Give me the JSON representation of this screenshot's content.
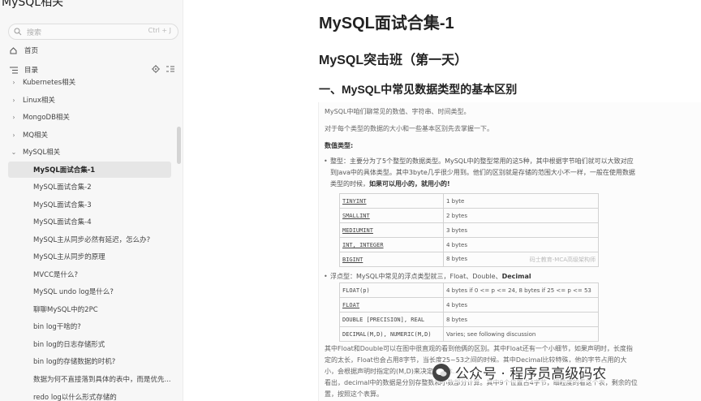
{
  "app": {
    "title": "MySQL相关"
  },
  "search": {
    "placeholder": "搜索",
    "shortcut": "Ctrl + J"
  },
  "nav": {
    "home": "首页",
    "toc": "目录"
  },
  "tree": [
    {
      "label": "Kubernetes相关",
      "expanded": false
    },
    {
      "label": "Linux相关",
      "expanded": false
    },
    {
      "label": "MongoDB相关",
      "expanded": false
    },
    {
      "label": "MQ相关",
      "expanded": false
    },
    {
      "label": "MySQL相关",
      "expanded": true
    }
  ],
  "children": [
    "MySQL面试合集-1",
    "MySQL面试合集-2",
    "MySQL面试合集-3",
    "MySQL面试合集-4",
    "MySQL主从同步必然有延迟，怎么办?",
    "MySQL主从同步的原理",
    "MVCC是什么?",
    "MySQL undo log是什么?",
    "聊聊MySQL中的2PC",
    "bin log干啥的?",
    "bin log的日志存储形式",
    "bin log的存储数据的时机?",
    "数据为何不直接落到具体的表中，而是优先...",
    "redo log以什么形式存储的"
  ],
  "article": {
    "title": "MySQL面试合集-1",
    "subtitle": "MySQL突击班（第一天）",
    "section": "一、MySQL中常见数据类型的基本区别",
    "intro1": "MySQL中咱们聊常见的数值、字符串、时间类型。",
    "intro2": "对于每个类型的数据的大小和一些基本区别先去掌握一下。",
    "numeric_heading": "数值类型:",
    "int_text_a": "整型：主要分为了5个整型的数据类型。MySQL中的整型常用的这5种，其中根据字节咱们就可以大致对应",
    "int_text_b": "到Java中的具体类型。其中3byte几乎很少用到。他们的区别就是存储的范围大小不一样，一般在使用数据",
    "int_text_c": "类型的时候，",
    "int_text_bold": "如果可以用小的，就用小的!",
    "int_table": [
      {
        "type": "TINYINT",
        "size": "1 byte"
      },
      {
        "type": "SMALLINT",
        "size": "2 bytes"
      },
      {
        "type": "MEDIUMINT",
        "size": "3 bytes"
      },
      {
        "type": "INT, INTEGER",
        "size": "4 bytes"
      },
      {
        "type": "BIGINT",
        "size": "8 bytes"
      }
    ],
    "float_text_a": "浮点型：MySQL中常见的浮点类型就三，Float、Double、",
    "float_text_bold": "Decimal",
    "float_table": [
      {
        "type": "FLOAT(p)",
        "size": "4 bytes if 0 <= p <= 24, 8 bytes if 25 <= p <= 53"
      },
      {
        "type": "FLOAT",
        "size": "4 bytes"
      },
      {
        "type": "DOUBLE [PRECISION], REAL",
        "size": "8 bytes"
      },
      {
        "type": "DECIMAL(M,D), NUMERIC(M,D)",
        "size": "Varies; see following discussion"
      }
    ],
    "para_a": "其中Float和Double可以在图中很直观的看到他俩的区别。其中Float还有一个小细节，如果声明时，长度指",
    "para_b": "定的太长，Float也会占用8字节，当长度25~53之间的时候。其中Decimal比较特殊，他的字节占用的大",
    "para_c": "小，会根据声明时指定的(M,D)来决定，具体……",
    "para_d": "看出，decimal中的数据是分别存整数和小数部分计算。其中9个位置占4字节，细粒度的看这个表，剩余的位",
    "para_e": "置，按照这个表算。"
  },
  "watermark": {
    "text": "码士教育-MCA高级架构师",
    "footer_brand": "公众号 · 程序员高级码农"
  }
}
